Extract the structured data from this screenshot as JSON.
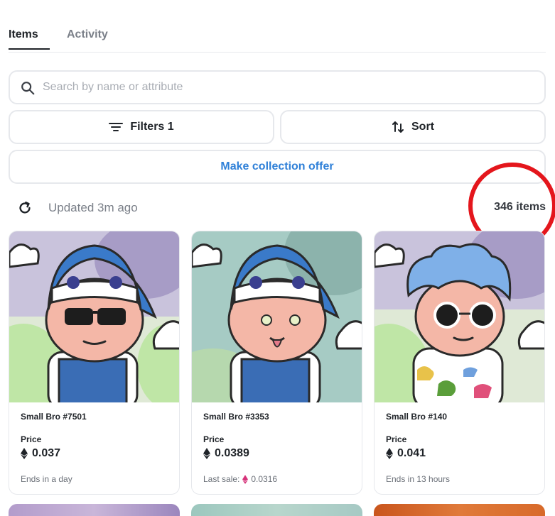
{
  "tabs": [
    {
      "label": "Items",
      "active": true
    },
    {
      "label": "Activity",
      "active": false
    }
  ],
  "search": {
    "placeholder": "Search by name or attribute",
    "value": "",
    "icon": "search-icon"
  },
  "toolbar": {
    "filters_label": "Filters 1",
    "filters_icon": "filter-lines-icon",
    "sort_label": "Sort",
    "sort_icon": "sort-arrows-icon",
    "offer_label": "Make collection offer"
  },
  "status": {
    "updated_text": "Updated 3m ago",
    "refresh_icon": "refresh-icon",
    "item_count": "346 items"
  },
  "colors": {
    "accent": "#2f80d8",
    "highlight_ring": "#e4161c",
    "muted_text": "#7b8089",
    "border": "#e6e8ec",
    "eth_icon": "#1f2328",
    "last_sale_eth_icon": "#d6337a"
  },
  "cards": [
    {
      "name": "Small Bro #7501",
      "price_label": "Price",
      "price": "0.037",
      "footer_text": "Ends in a day",
      "background": "#dfe9d6",
      "character": "shark-hood-sunglasses"
    },
    {
      "name": "Small Bro #3353",
      "price_label": "Price",
      "price": "0.0389",
      "footer_text": "Last sale:",
      "footer_price": "0.0316",
      "background": "#a6cbc4",
      "character": "shark-hood-tongue"
    },
    {
      "name": "Small Bro #140",
      "price_label": "Price",
      "price": "0.041",
      "footer_text": "Ends in 13 hours",
      "background": "#dfe9d6",
      "character": "blue-hair-round-sunglasses"
    }
  ]
}
